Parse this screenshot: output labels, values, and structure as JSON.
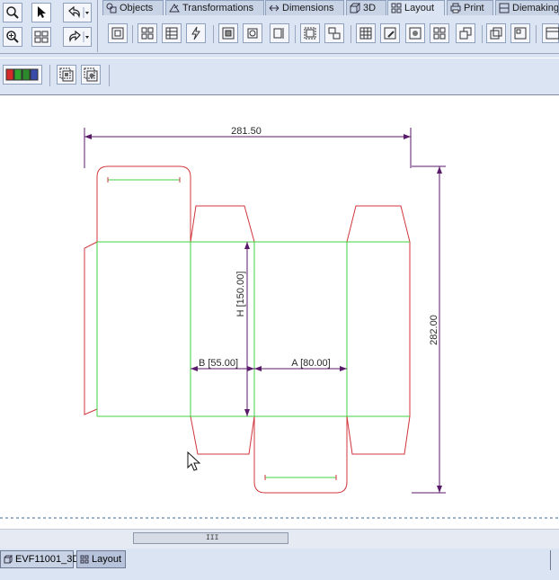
{
  "tabs": [
    {
      "label": "Objects",
      "icon": "objects-icon"
    },
    {
      "label": "Transformations",
      "icon": "transformations-icon"
    },
    {
      "label": "Dimensions",
      "icon": "dimensions-icon"
    },
    {
      "label": "3D",
      "icon": "3d-icon"
    },
    {
      "label": "Layout",
      "icon": "layout-icon",
      "active": true
    },
    {
      "label": "Print",
      "icon": "print-icon"
    },
    {
      "label": "Diemaking",
      "icon": "diemaking-icon"
    }
  ],
  "drawing": {
    "overall_width": "281.50",
    "overall_height": "282.00",
    "height_label": "H [150.00]",
    "depth_label": "B [55.00]",
    "width_label": "A [80.00]"
  },
  "doc_tabs": [
    {
      "label": "EVF11001_3D",
      "icon": "3d-document-icon"
    },
    {
      "label": "Layout",
      "icon": "layout-icon",
      "active": true
    }
  ],
  "scrollbar": {
    "grip": "III"
  },
  "colors": {
    "cut_line": "#d0363c",
    "crease_line": "#43d043",
    "dimension_line": "#5a1a6a",
    "toolbar_bg": "#dbe4f2"
  }
}
